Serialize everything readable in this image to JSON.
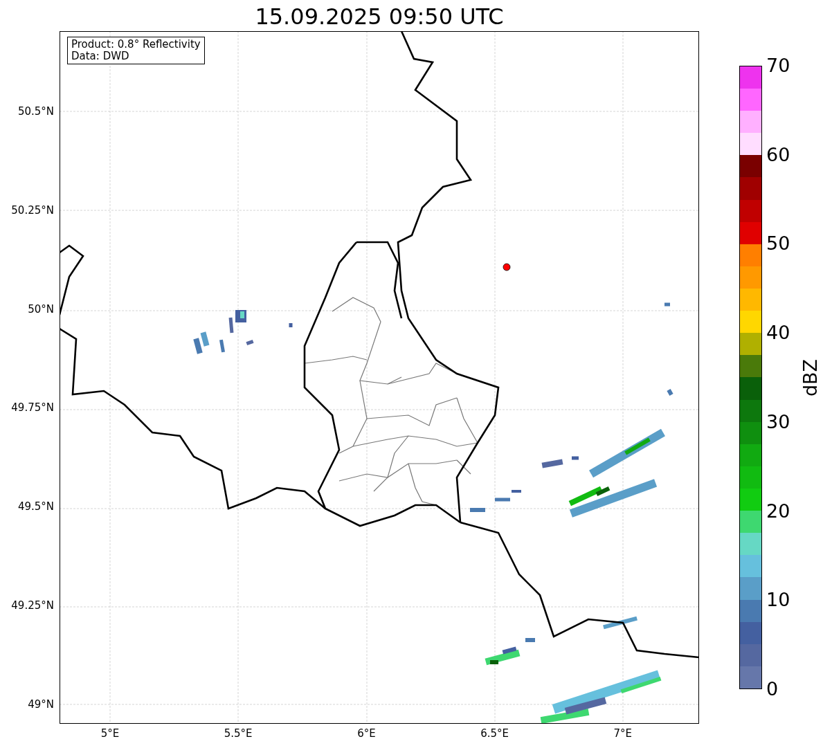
{
  "title": "15.09.2025 09:50 UTC",
  "info_box": [
    "Product: 0.8° Reflectivity",
    "Data: DWD"
  ],
  "lat_ticks": [
    "50.5°N",
    "50.25°N",
    "50°N",
    "49.75°N",
    "49.5°N",
    "49.25°N",
    "49°N"
  ],
  "lon_ticks": [
    "5°E",
    "5.5°E",
    "6°E",
    "6.5°E",
    "7°E"
  ],
  "colorbar": {
    "label": "dBZ",
    "ticks": [
      "70",
      "60",
      "50",
      "40",
      "30",
      "20",
      "10",
      "0"
    ],
    "segments": [
      {
        "color": "#6677aa"
      },
      {
        "color": "#5568a0"
      },
      {
        "color": "#4460a0"
      },
      {
        "color": "#4a7ab0"
      },
      {
        "color": "#5a9ec8"
      },
      {
        "color": "#66c0dd"
      },
      {
        "color": "#66d8c4"
      },
      {
        "color": "#3ed870"
      },
      {
        "color": "#11cc11"
      },
      {
        "color": "#11bb11"
      },
      {
        "color": "#11aa11"
      },
      {
        "color": "#0f8f0f"
      },
      {
        "color": "#0d780d"
      },
      {
        "color": "#0a600a"
      },
      {
        "color": "#4a7a0a"
      },
      {
        "color": "#b0b000"
      },
      {
        "color": "#ffd700"
      },
      {
        "color": "#ffb800"
      },
      {
        "color": "#ff9900"
      },
      {
        "color": "#ff7f00"
      },
      {
        "color": "#e00000"
      },
      {
        "color": "#c00000"
      },
      {
        "color": "#a00000"
      },
      {
        "color": "#7a0000"
      },
      {
        "color": "#ffddff"
      },
      {
        "color": "#ffb0ff"
      },
      {
        "color": "#ff66ff"
      },
      {
        "color": "#ee33ee"
      }
    ]
  }
}
